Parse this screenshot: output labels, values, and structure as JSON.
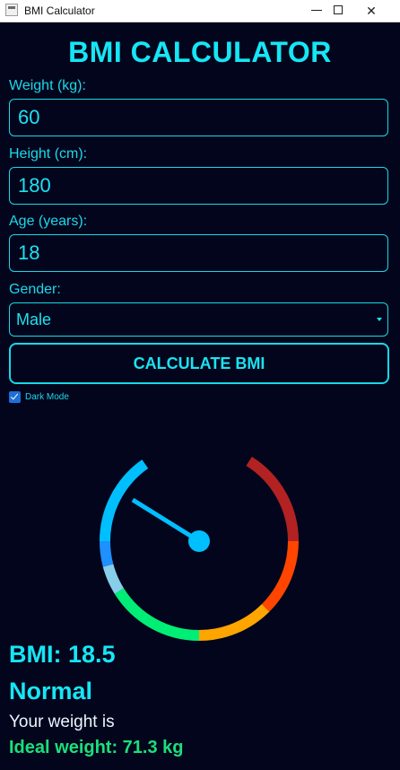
{
  "window": {
    "title": "BMI Calculator",
    "minimize_glyph": "",
    "maximize_glyph": "",
    "close_glyph": "✕"
  },
  "app_title": "BMI CALCULATOR",
  "form": {
    "weight_label": "Weight (kg):",
    "weight_value": "60",
    "height_label": "Height (cm):",
    "height_value": "180",
    "age_label": "Age (years):",
    "age_value": "18",
    "gender_label": "Gender:",
    "gender_value": "Male",
    "calculate_label": "CALCULATE BMI",
    "dark_mode_label": "Dark Mode",
    "dark_mode_checked": true
  },
  "gauge": {
    "bmi": 18.5,
    "needle_color": "#00bfff",
    "segments": [
      {
        "color": "#00bfff"
      },
      {
        "color": "#1e90ff"
      },
      {
        "color": "#87ceeb"
      },
      {
        "color": "#00ee76"
      },
      {
        "color": "#ffa500"
      },
      {
        "color": "#ff4500"
      },
      {
        "color": "#b22222"
      }
    ]
  },
  "result": {
    "bmi_text": "BMI: 18.5",
    "category": "Normal",
    "message": "Your weight is",
    "ideal_weight": "Ideal weight: 71.3 kg"
  },
  "colors": {
    "background": "#03051c",
    "accent": "#15e6f5",
    "ideal": "#19e07c"
  }
}
